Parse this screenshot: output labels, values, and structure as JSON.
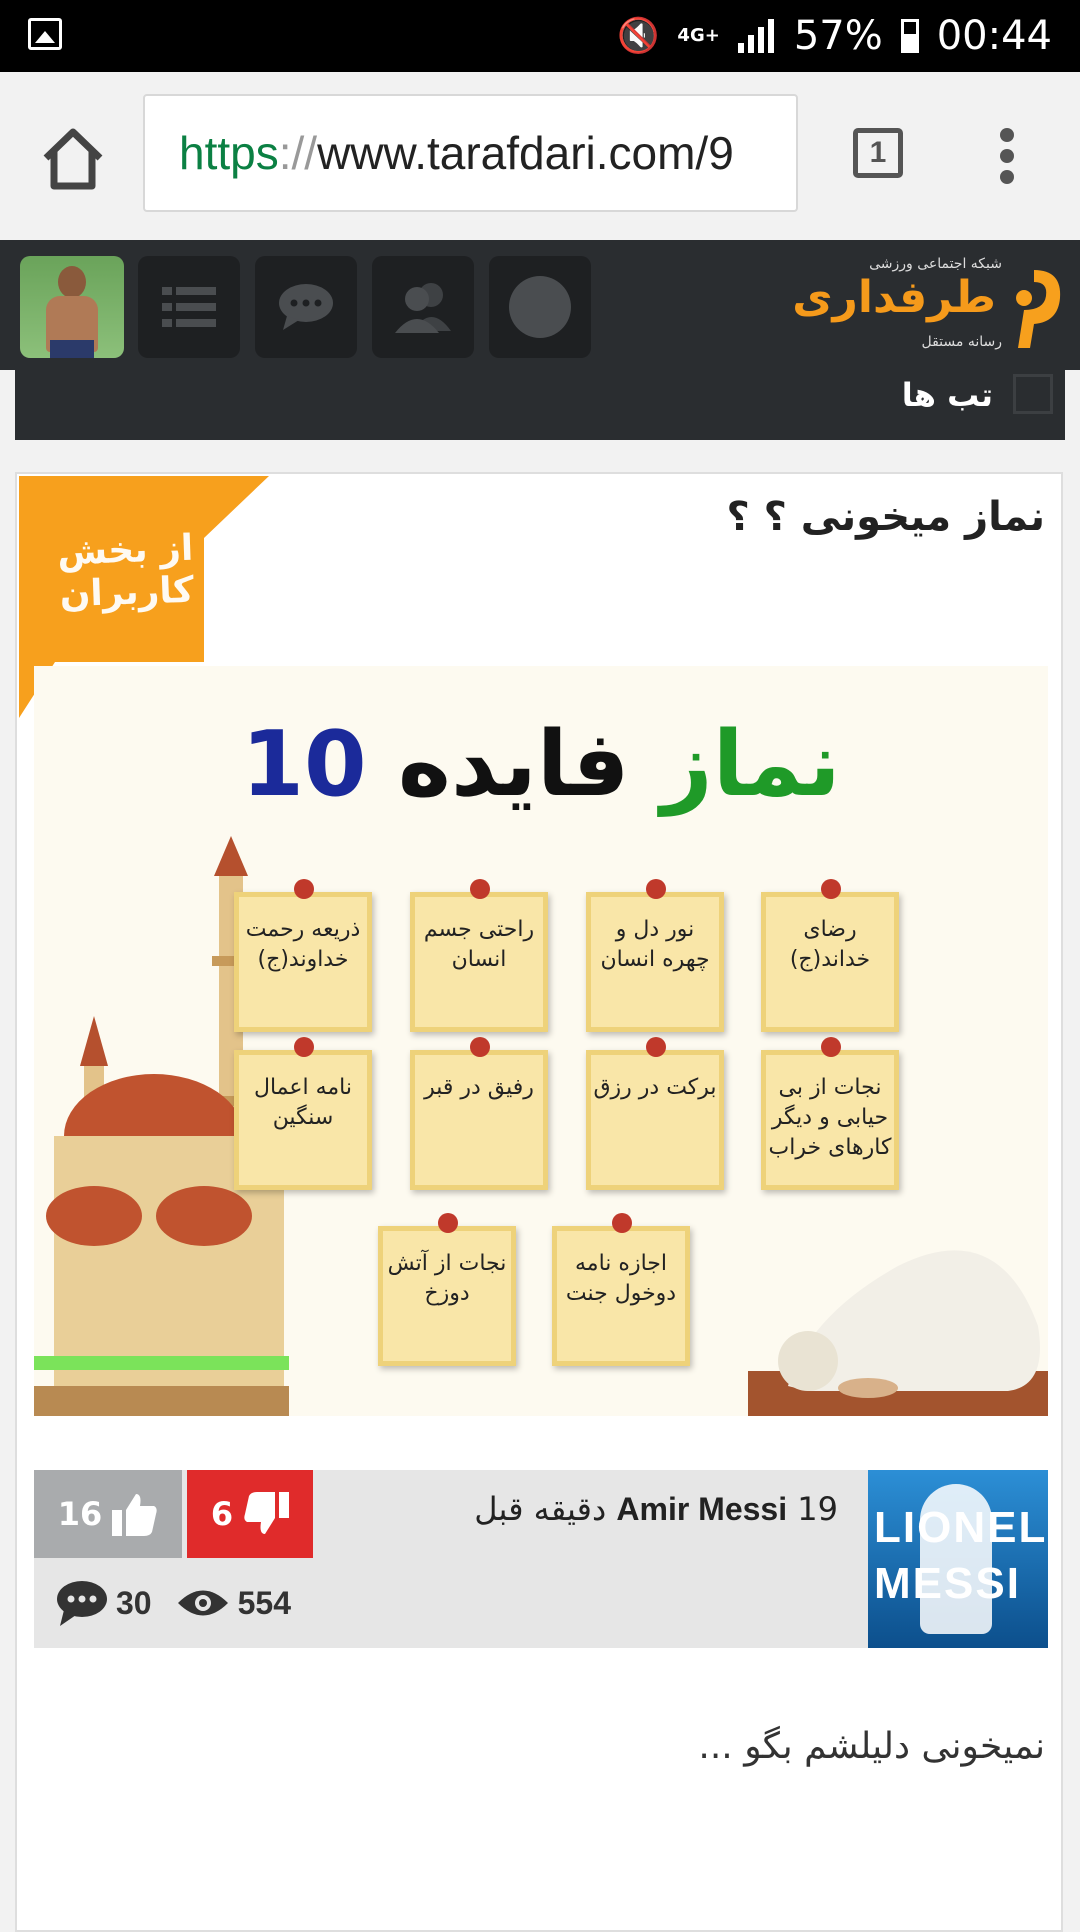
{
  "status_bar": {
    "network": "4G+",
    "battery": "57%",
    "time": "00:44"
  },
  "browser": {
    "url_scheme": "https",
    "url_separator": "://",
    "url_rest": "www.tarafdari.com/9",
    "tab_count": "1"
  },
  "site": {
    "logo_name": "طرفداری",
    "logo_tagline_top": "شبکه اجتماعی ورزشی",
    "logo_tagline_bottom": "رسانه مستقل",
    "tags_label": "تب ها"
  },
  "post": {
    "ribbon_text": "از بخش کاربران",
    "title": "نماز میخونی ؟ ؟",
    "image": {
      "headline_green": "نماز",
      "headline_black": "فایده",
      "headline_blue": "10",
      "notes": [
        "رضای خداند(ج)",
        "نور دل و چهره انسان",
        "راحتی جسم انسان",
        "ذریعه رحمت خداوند(ج)",
        "نجات از بی حیابی و دیگر کارهای خراب",
        "برکت در رزق",
        "رفیق در قبر",
        "نامه اعمال سنگین",
        "اجازه نامه دوخول جنت",
        "نجات از آتش دوزخ"
      ]
    },
    "author": "Amir Messi",
    "time_ago": "19 دقیقه قبل",
    "author_avatar_text": "LIONEL MESSI",
    "likes": "16",
    "dislikes": "6",
    "comments": "30",
    "views": "554",
    "excerpt": "نمیخونی دلیلشم بگو ..."
  },
  "colors": {
    "accent_orange": "#f7a01d",
    "dislike_red": "#e02b2b",
    "header_dark": "#2a2d30"
  }
}
